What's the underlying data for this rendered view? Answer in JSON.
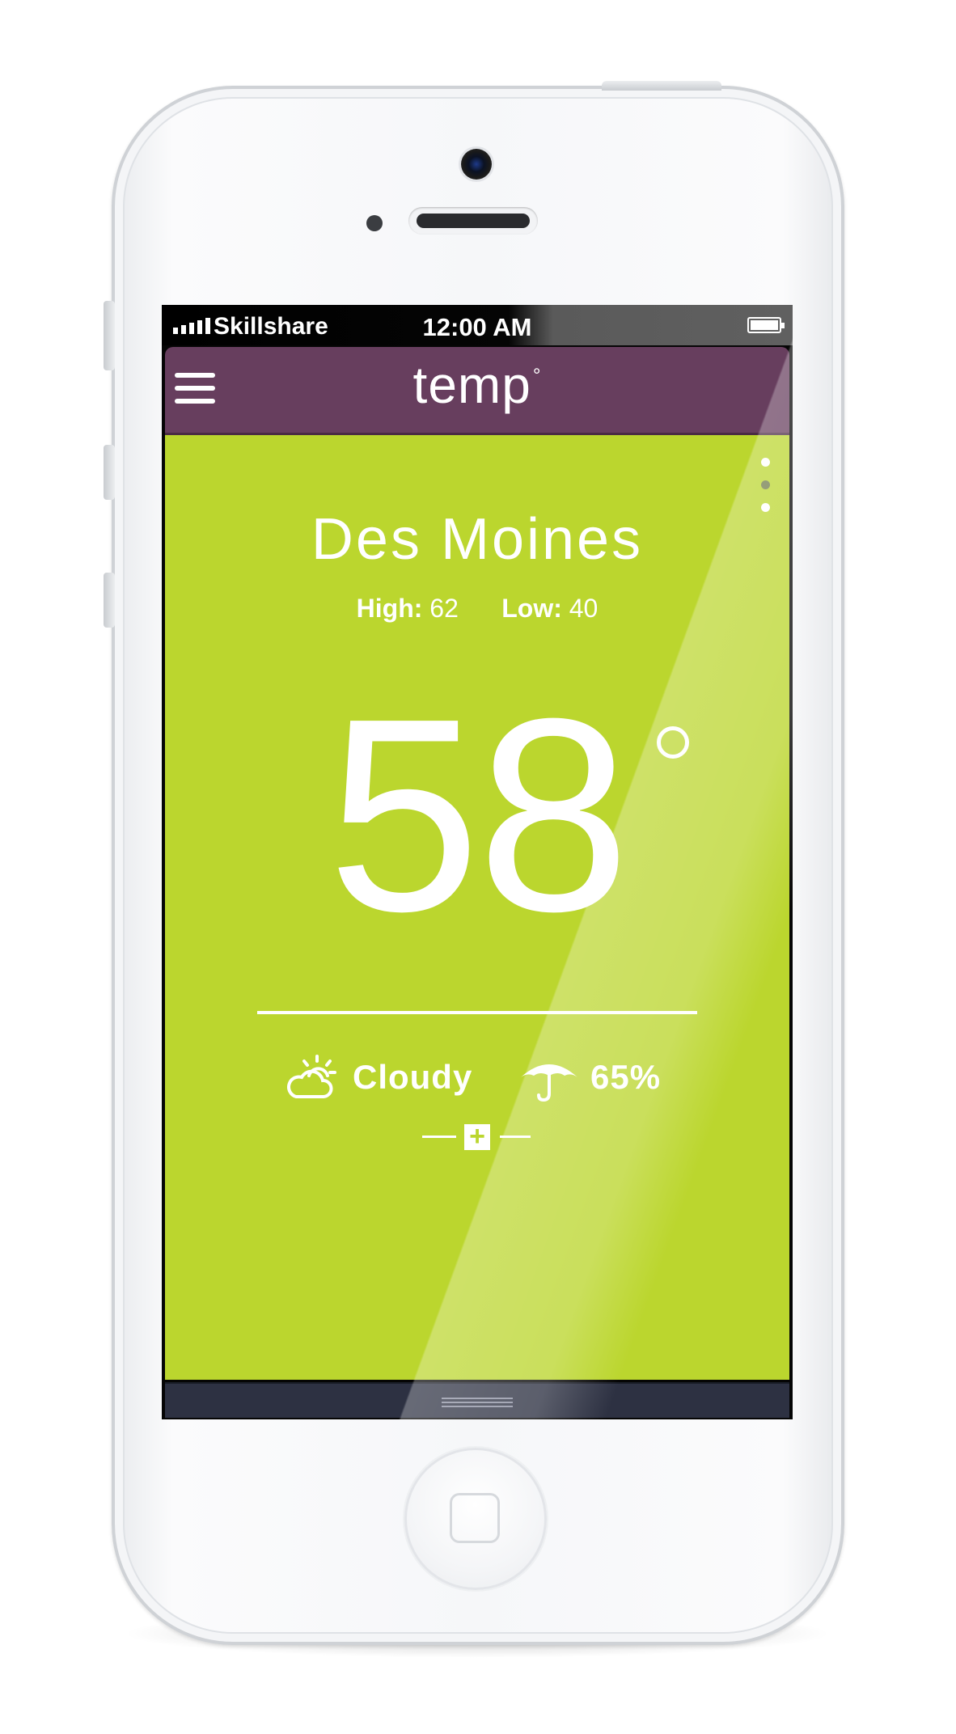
{
  "status_bar": {
    "carrier": "Skillshare",
    "time": "12:00 AM",
    "signal_icon": "signal-bars-icon",
    "battery_icon": "battery-icon"
  },
  "nav": {
    "title": "temp",
    "title_degree": "°",
    "menu_icon": "hamburger-menu-icon"
  },
  "weather": {
    "city": "Des Moines",
    "high_label": "High:",
    "high_value": "62",
    "low_label": "Low:",
    "low_value": "40",
    "temperature": "58",
    "condition": "Cloudy",
    "condition_icon": "partly-cloudy-icon",
    "precipitation": "65%",
    "precipitation_icon": "umbrella-icon",
    "more_label": "+"
  },
  "pager": {
    "total_pages": 3,
    "active_page": 2
  },
  "colors": {
    "nav_background": "#673e5e",
    "content_background": "#bbd62e",
    "bottom_bar": "#2d3142",
    "text": "#ffffff"
  }
}
